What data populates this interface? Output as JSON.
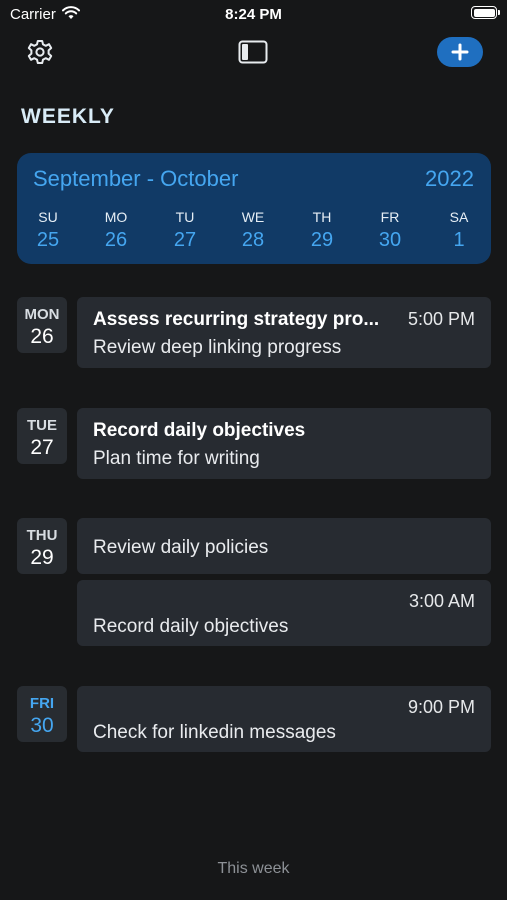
{
  "status_bar": {
    "carrier": "Carrier",
    "time": "8:24 PM"
  },
  "toolbar": {
    "settings_icon": "gear-icon",
    "sidebar_icon": "sidebar-toggle-icon",
    "add_label": "+"
  },
  "heading": "WEEKLY",
  "calendar": {
    "range": "September - October",
    "year": "2022",
    "days": [
      {
        "dow": "SU",
        "num": "25"
      },
      {
        "dow": "MO",
        "num": "26"
      },
      {
        "dow": "TU",
        "num": "27"
      },
      {
        "dow": "WE",
        "num": "28"
      },
      {
        "dow": "TH",
        "num": "29"
      },
      {
        "dow": "FR",
        "num": "30"
      },
      {
        "dow": "SA",
        "num": "1"
      }
    ]
  },
  "groups": [
    {
      "dow": "MON",
      "num": "26",
      "events": [
        {
          "title": "Assess recurring strategy pro...",
          "time": "5:00 PM",
          "subtitle": "Review deep linking progress"
        }
      ]
    },
    {
      "dow": "TUE",
      "num": "27",
      "events": [
        {
          "title": "Record daily objectives",
          "subtitle": "Plan time for writing"
        }
      ]
    },
    {
      "dow": "THU",
      "num": "29",
      "events": [
        {
          "subtitle": "Review daily policies"
        },
        {
          "time": "3:00 AM",
          "subtitle": "Record daily objectives"
        }
      ]
    },
    {
      "dow": "FRI",
      "num": "30",
      "events": [
        {
          "time": "9:00 PM",
          "subtitle": "Check for linkedin messages"
        }
      ]
    }
  ],
  "footer": "This week",
  "colors": {
    "accent": "#45a6f0",
    "calendar_bg": "#113a66",
    "card_bg": "#272b31",
    "button": "#1f6fc0"
  }
}
